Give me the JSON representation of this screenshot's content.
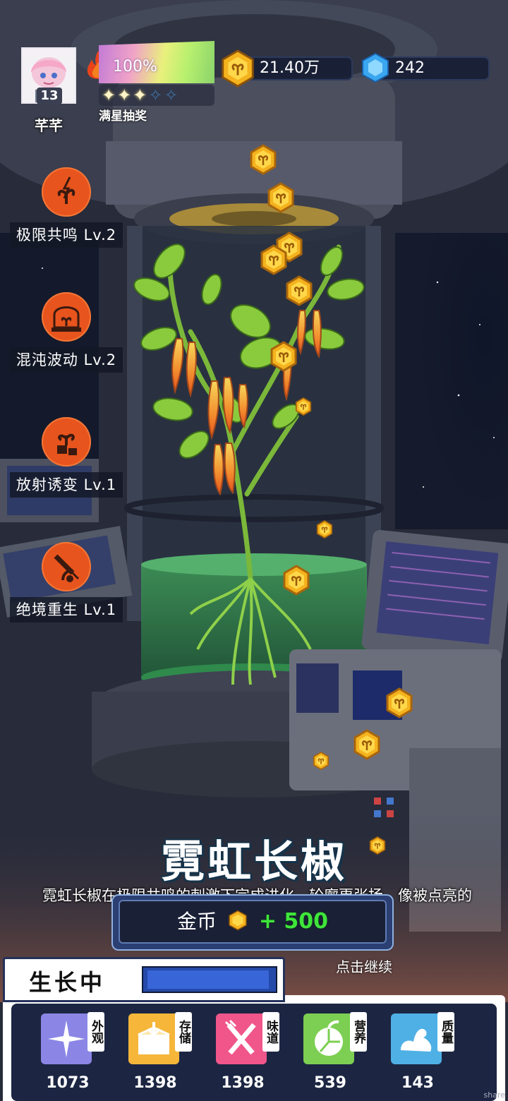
{
  "player": {
    "name": "芊芊",
    "level": "13"
  },
  "heat": {
    "percent": "100%",
    "stars_filled": 3,
    "stars_total": 5,
    "star_label": "满星抽奖"
  },
  "resources": {
    "coins": "21.40万",
    "gems": "242"
  },
  "skills": [
    {
      "label": "极限共鸣 Lv.2",
      "icon": "lightning-sprout-icon"
    },
    {
      "label": "混沌波动 Lv.2",
      "icon": "greenhouse-icon"
    },
    {
      "label": "放射诱变 Lv.1",
      "icon": "sprout-box-icon"
    },
    {
      "label": "绝境重生 Lv.1",
      "icon": "syringe-plant-icon"
    }
  ],
  "plant": {
    "name": "霓虹长椒",
    "description": "霓虹长椒在极限共鸣的刺激下完成进化，轮廓更张扬，像被点亮的"
  },
  "reward": {
    "label": "金币",
    "amount": "+ 500"
  },
  "continue_label": "点击继续",
  "growth": {
    "label": "生长中",
    "progress": 0.98
  },
  "stats": [
    {
      "tag": "外观",
      "value": "1073",
      "icon": "sparkle-icon",
      "color": "#8b86e6"
    },
    {
      "tag": "存储",
      "value": "1398",
      "icon": "box-icon",
      "color": "#f5b63a"
    },
    {
      "tag": "味道",
      "value": "1398",
      "icon": "utensils-icon",
      "color": "#f0568a"
    },
    {
      "tag": "营养",
      "value": "539",
      "icon": "lemon-icon",
      "color": "#7ccf52"
    },
    {
      "tag": "质量",
      "value": "143",
      "icon": "muscle-icon",
      "color": "#4fb0e6"
    }
  ],
  "watermark": "share"
}
